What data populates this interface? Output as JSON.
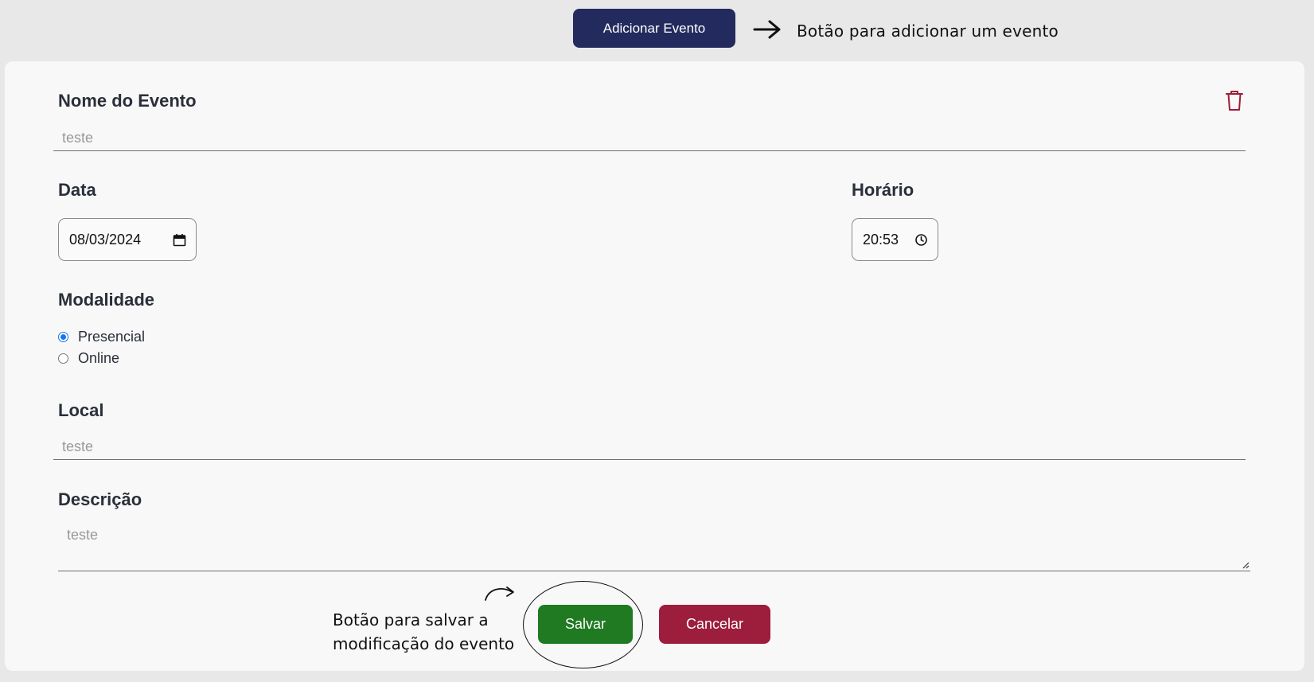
{
  "toolbar": {
    "add_event_label": "Adicionar Evento",
    "add_event_annotation": "Botão para adicionar um evento"
  },
  "form": {
    "event_name": {
      "label": "Nome do Evento",
      "value": "teste"
    },
    "date": {
      "label": "Data",
      "value": "08/03/2024"
    },
    "time": {
      "label": "Horário",
      "value": "20:53"
    },
    "modality": {
      "label": "Modalidade",
      "options": [
        {
          "label": "Presencial",
          "checked": true
        },
        {
          "label": "Online",
          "checked": false
        }
      ]
    },
    "location": {
      "label": "Local",
      "value": "teste"
    },
    "description": {
      "label": "Descrição",
      "value": "teste"
    }
  },
  "actions": {
    "save_label": "Salvar",
    "cancel_label": "Cancelar",
    "save_annotation_line1": "Botão para salvar a",
    "save_annotation_line2": "modificação do evento"
  },
  "colors": {
    "add_button": "#232a5e",
    "save_button": "#1f7a22",
    "cancel_button": "#9c1d3c",
    "trash_icon": "#9c1d3c",
    "radio_accent": "#1a73e8"
  }
}
